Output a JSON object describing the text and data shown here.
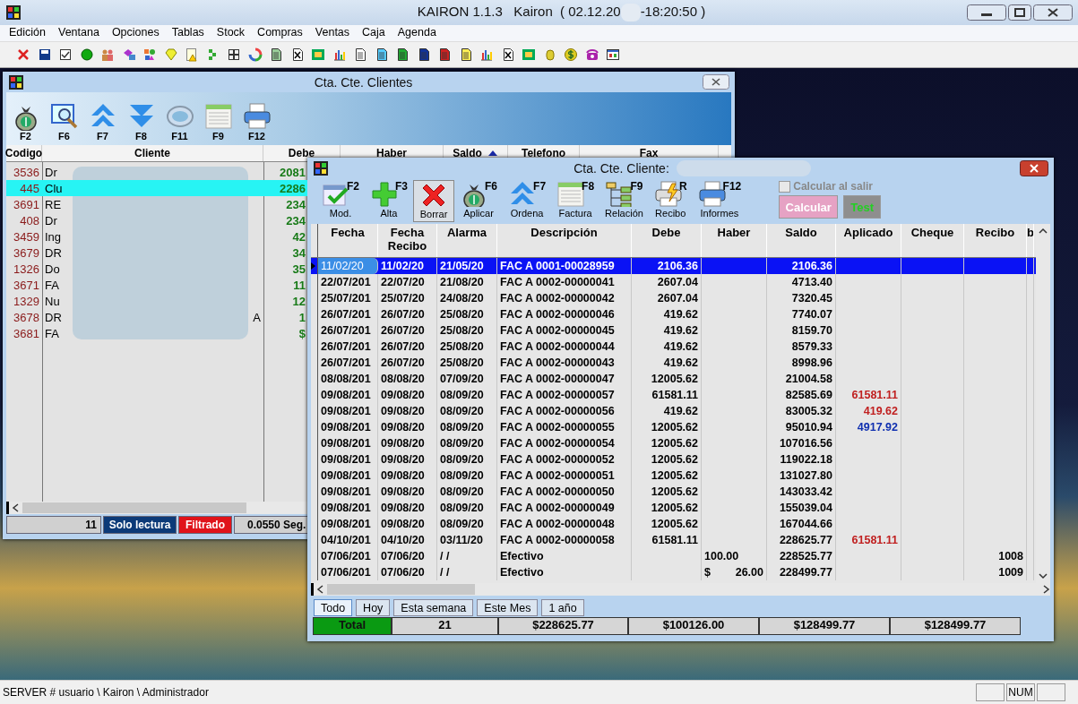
{
  "app": {
    "title": "KAIRON 1.1.3   Kairon  ( 02.12.20",
    "title_end": "-18:20:50 )"
  },
  "menu": [
    "Edición",
    "Ventana",
    "Opciones",
    "Tablas",
    "Stock",
    "Compras",
    "Ventas",
    "Caja",
    "Agenda"
  ],
  "list_window": {
    "title": "Cta. Cte. Clientes",
    "tools": [
      "F2",
      "F6",
      "F7",
      "F8",
      "F11",
      "F9",
      "F12"
    ],
    "columns": [
      {
        "label": "Codigo",
        "sorted": false
      },
      {
        "label": "Cliente",
        "sorted": false
      },
      {
        "label": "Debe",
        "sorted": false
      },
      {
        "label": "Haber",
        "sorted": false
      },
      {
        "label": "Saldo",
        "sorted": true
      },
      {
        "label": "Telefono",
        "sorted": false
      },
      {
        "label": "Fax",
        "sorted": false
      }
    ],
    "rows": [
      {
        "codigo": "3536",
        "cliente": "Dr",
        "debe": "2081",
        "selected": false
      },
      {
        "codigo": "445",
        "cliente": "Clu",
        "debe": "2286",
        "selected": true
      },
      {
        "codigo": "3691",
        "cliente": "RE",
        "debe": "234",
        "selected": false
      },
      {
        "codigo": "408",
        "cliente": "Dr",
        "debe": "234",
        "selected": false
      },
      {
        "codigo": "3459",
        "cliente": "Ing",
        "debe": "42",
        "selected": false
      },
      {
        "codigo": "3679",
        "cliente": "DR",
        "debe": "34",
        "selected": false
      },
      {
        "codigo": "1326",
        "cliente": "Do",
        "debe": "35",
        "selected": false
      },
      {
        "codigo": "3671",
        "cliente": "FA",
        "debe": "11",
        "selected": false
      },
      {
        "codigo": "1329",
        "cliente": "Nu",
        "debe": "12",
        "selected": false
      },
      {
        "codigo": "3678",
        "cliente": "DR",
        "cliente_tail": "A",
        "debe": "1",
        "selected": false
      },
      {
        "codigo": "3681",
        "cliente": "FA",
        "debe": "$",
        "selected": false
      }
    ],
    "status": {
      "count": "11",
      "mode": "Solo lectura",
      "filter": "Filtrado",
      "time": "0.0550 Seg."
    }
  },
  "detail_window": {
    "title": "Cta. Cte. Cliente:",
    "tools": [
      {
        "label": "Mod.",
        "key": "F2",
        "pressed": false
      },
      {
        "label": "Alta",
        "key": "F3",
        "pressed": false
      },
      {
        "label": "Borrar",
        "pressed": true
      },
      {
        "label": "Aplicar",
        "key": "F6",
        "pressed": false
      },
      {
        "label": "Ordena",
        "key": "F7",
        "pressed": false
      },
      {
        "label": "Factura",
        "key": "F8",
        "pressed": false
      },
      {
        "label": "Relación",
        "key": "F9",
        "pressed": false
      },
      {
        "label": "Recibo",
        "key": "R",
        "pressed": false
      },
      {
        "label": "Informes",
        "key": "F12",
        "pressed": false
      }
    ],
    "calc_on_exit": {
      "label": "Calcular al salir",
      "checked": false,
      "disabled": true
    },
    "buttons": [
      {
        "label": "Calcular",
        "kind": "calc",
        "disabled": true
      },
      {
        "label": "Test",
        "kind": "test",
        "disabled": true
      }
    ],
    "columns": [
      "Fecha",
      "Fecha Recibo",
      "Alarma",
      "Descripción",
      "Debe",
      "Haber",
      "Saldo",
      "Aplicado",
      "Cheque",
      "Recibo",
      "b"
    ],
    "rows": [
      {
        "fecha": "11/02/20",
        "fecha_recibo": "11/02/20",
        "alarma": "21/05/20",
        "descripcion": "FAC A 0001-00028959",
        "debe": "2106.36",
        "saldo": "2106.36",
        "selected": true
      },
      {
        "fecha": "22/07/201",
        "fecha_recibo": "22/07/20",
        "alarma": "21/08/20",
        "descripcion": "FAC A 0002-00000041",
        "debe": "2607.04",
        "saldo": "4713.40",
        "selected": false
      },
      {
        "fecha": "25/07/201",
        "fecha_recibo": "25/07/20",
        "alarma": "24/08/20",
        "descripcion": "FAC A 0002-00000042",
        "debe": "2607.04",
        "saldo": "7320.45",
        "selected": false
      },
      {
        "fecha": "26/07/201",
        "fecha_recibo": "26/07/20",
        "alarma": "25/08/20",
        "descripcion": "FAC A 0002-00000046",
        "debe": "419.62",
        "saldo": "7740.07",
        "selected": false
      },
      {
        "fecha": "26/07/201",
        "fecha_recibo": "26/07/20",
        "alarma": "25/08/20",
        "descripcion": "FAC A 0002-00000045",
        "debe": "419.62",
        "saldo": "8159.70",
        "selected": false
      },
      {
        "fecha": "26/07/201",
        "fecha_recibo": "26/07/20",
        "alarma": "25/08/20",
        "descripcion": "FAC A 0002-00000044",
        "debe": "419.62",
        "saldo": "8579.33",
        "selected": false
      },
      {
        "fecha": "26/07/201",
        "fecha_recibo": "26/07/20",
        "alarma": "25/08/20",
        "descripcion": "FAC A 0002-00000043",
        "debe": "419.62",
        "saldo": "8998.96",
        "selected": false
      },
      {
        "fecha": "08/08/201",
        "fecha_recibo": "08/08/20",
        "alarma": "07/09/20",
        "descripcion": "FAC A 0002-00000047",
        "debe": "12005.62",
        "saldo": "21004.58",
        "selected": false
      },
      {
        "fecha": "09/08/201",
        "fecha_recibo": "09/08/20",
        "alarma": "08/09/20",
        "descripcion": "FAC A 0002-00000057",
        "debe": "61581.11",
        "saldo": "82585.69",
        "aplicado": {
          "text": "61581.11",
          "color": "#c02020"
        },
        "selected": false
      },
      {
        "fecha": "09/08/201",
        "fecha_recibo": "09/08/20",
        "alarma": "08/09/20",
        "descripcion": "FAC A 0002-00000056",
        "debe": "419.62",
        "saldo": "83005.32",
        "aplicado": {
          "text": "419.62",
          "color": "#c02020"
        },
        "selected": false
      },
      {
        "fecha": "09/08/201",
        "fecha_recibo": "09/08/20",
        "alarma": "08/09/20",
        "descripcion": "FAC A 0002-00000055",
        "debe": "12005.62",
        "saldo": "95010.94",
        "aplicado": {
          "text": "4917.92",
          "color": "#1030b0"
        },
        "selected": false
      },
      {
        "fecha": "09/08/201",
        "fecha_recibo": "09/08/20",
        "alarma": "08/09/20",
        "descripcion": "FAC A 0002-00000054",
        "debe": "12005.62",
        "saldo": "107016.56",
        "selected": false
      },
      {
        "fecha": "09/08/201",
        "fecha_recibo": "09/08/20",
        "alarma": "08/09/20",
        "descripcion": "FAC A 0002-00000052",
        "debe": "12005.62",
        "saldo": "119022.18",
        "selected": false
      },
      {
        "fecha": "09/08/201",
        "fecha_recibo": "09/08/20",
        "alarma": "08/09/20",
        "descripcion": "FAC A 0002-00000051",
        "debe": "12005.62",
        "saldo": "131027.80",
        "selected": false
      },
      {
        "fecha": "09/08/201",
        "fecha_recibo": "09/08/20",
        "alarma": "08/09/20",
        "descripcion": "FAC A 0002-00000050",
        "debe": "12005.62",
        "saldo": "143033.42",
        "selected": false
      },
      {
        "fecha": "09/08/201",
        "fecha_recibo": "09/08/20",
        "alarma": "08/09/20",
        "descripcion": "FAC A 0002-00000049",
        "debe": "12005.62",
        "saldo": "155039.04",
        "selected": false
      },
      {
        "fecha": "09/08/201",
        "fecha_recibo": "09/08/20",
        "alarma": "08/09/20",
        "descripcion": "FAC A 0002-00000048",
        "debe": "12005.62",
        "saldo": "167044.66",
        "selected": false
      },
      {
        "fecha": "04/10/201",
        "fecha_recibo": "04/10/20",
        "alarma": "03/11/20",
        "descripcion": "FAC A 0002-00000058",
        "debe": "61581.11",
        "saldo": "228625.77",
        "aplicado": {
          "text": "61581.11",
          "color": "#c02020"
        },
        "selected": false
      },
      {
        "fecha": "07/06/201",
        "fecha_recibo": "07/06/20",
        "alarma": "/ /",
        "descripcion": "Efectivo",
        "haber": "100.00",
        "saldo": "228525.77",
        "recibo": "1008",
        "selected": false
      },
      {
        "fecha": "07/06/201",
        "fecha_recibo": "07/06/20",
        "alarma": "/ /",
        "descripcion": "Efectivo",
        "haber_prefix": "$",
        "haber": "26.00",
        "saldo": "228499.77",
        "recibo": "1009",
        "selected": false
      }
    ],
    "filters": [
      {
        "label": "Todo",
        "selected": true
      },
      {
        "label": "Hoy",
        "selected": false
      },
      {
        "label": "Esta semana",
        "selected": false
      },
      {
        "label": "Este Mes",
        "selected": false
      },
      {
        "label": "1 año",
        "selected": false
      }
    ],
    "totals": [
      "Total",
      "21",
      "$228625.77",
      "$100126.00",
      "$128499.77",
      "$128499.77"
    ]
  },
  "status_bar": {
    "text": "SERVER # usuario \\ Kairon \\ Administrador",
    "indicators": [
      "NUM"
    ]
  }
}
